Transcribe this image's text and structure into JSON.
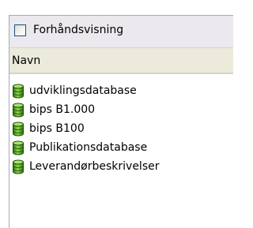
{
  "preview": {
    "label": "Forhåndsvisning",
    "checked": false
  },
  "list_header": {
    "column_label": "Navn"
  },
  "databases": [
    {
      "label": "udviklingsdatabase",
      "icon": "database-icon"
    },
    {
      "label": "bips B1.000",
      "icon": "database-icon"
    },
    {
      "label": "bips B100",
      "icon": "database-icon"
    },
    {
      "label": "Publikationsdatabase",
      "icon": "database-icon"
    },
    {
      "label": "Leverandørbeskrivelser",
      "icon": "database-icon"
    }
  ],
  "colors": {
    "database_icon": "#4a9a1c",
    "header_background": "#ebeadb",
    "checkbox_border": "#1c5180"
  }
}
